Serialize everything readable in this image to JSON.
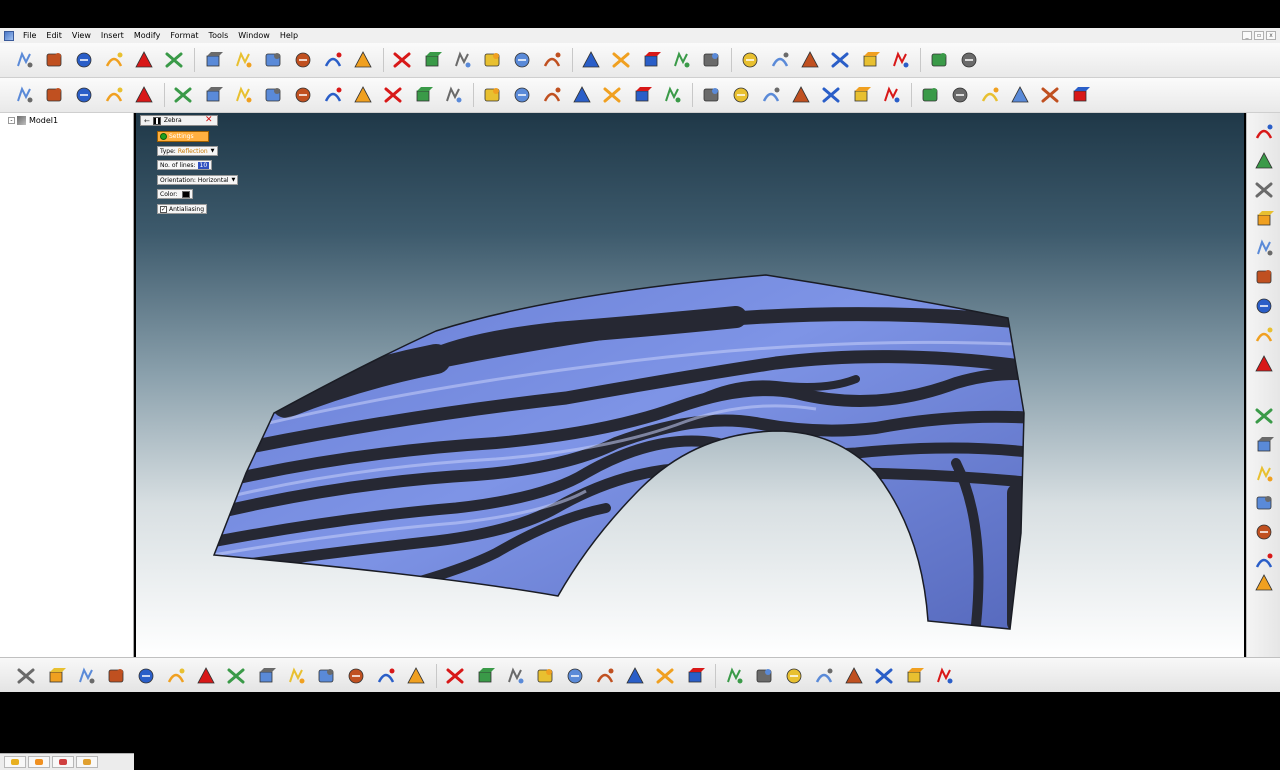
{
  "menubar": {
    "items": [
      "File",
      "Edit",
      "View",
      "Insert",
      "Modify",
      "Format",
      "Tools",
      "Window",
      "Help"
    ]
  },
  "tree": {
    "root_label": "Model1"
  },
  "zebra_panel": {
    "title": "Zebra",
    "check_label": "Settings",
    "type_label": "Type:",
    "type_value": "Reflection",
    "lines_label": "No. of lines:",
    "lines_value": "10",
    "orientation_label": "Orientation:",
    "orientation_value": "Horizontal",
    "color_label": "Color:",
    "antialias_label": "Antialiasing"
  },
  "colors": {
    "viewport_top": "#1f3848",
    "viewport_bottom": "#ffffff",
    "surface_light": "#7e94e6",
    "surface_dark": "#2a2c38",
    "accent_orange": "#f0a020",
    "accent_red": "#d81818",
    "accent_blue": "#2a5ec8"
  },
  "icons": {
    "toolbar1": [
      "new-icon",
      "open-icon",
      "save-icon",
      "undo-icon",
      "redo-icon",
      "copy-icon",
      "box-icon",
      "sphere-icon",
      "move-icon",
      "zoom-icon",
      "fit-icon",
      "grid-icon",
      "table-icon",
      "render-icon",
      "shade-icon",
      "wire-icon",
      "light-icon",
      "help-icon",
      "delete-icon",
      "trim-icon",
      "blend-icon",
      "extend-icon",
      "split-icon",
      "select-icon",
      "pick-icon",
      "measure-icon",
      "analyze-icon",
      "check-icon",
      "dimension-icon",
      "pen-icon",
      "brush-icon"
    ],
    "toolbar2": [
      "curve-icon",
      "line-icon",
      "circle-icon",
      "rectangle-icon",
      "arc-icon",
      "fillet-icon",
      "spline-icon",
      "offset-icon",
      "arrow-icon",
      "project-icon",
      "ellipse-icon",
      "mirror-icon",
      "swap-icon",
      "bottle-icon",
      "loop-icon",
      "sweep-icon",
      "loft-icon",
      "surface-icon",
      "patch-icon",
      "net-icon",
      "revolve-icon",
      "cap-icon",
      "image-icon",
      "texture-icon",
      "material-icon",
      "layer-icon",
      "scene-icon",
      "camera-icon",
      "view-icon",
      "orbit-icon",
      "section-icon",
      "frame-icon",
      "cube-icon",
      "cube2-icon",
      "cube3-icon"
    ],
    "right": [
      "sketch-icon",
      "trim-curve-icon",
      "extend-curve-icon",
      "fillet-curve-icon",
      "blend-curve-icon",
      "offset-curve-icon",
      "project-curve-icon",
      "intersect-icon",
      "silhouette-icon",
      "point-icon",
      "rotate-icon",
      "scale-icon",
      "mirror3d-icon",
      "array-icon",
      "align-icon",
      "attract-icon"
    ],
    "bottom": [
      "extrude-icon",
      "prism-icon",
      "revolve-solid-icon",
      "sweep-solid-icon",
      "loft-solid-icon",
      "shell-icon",
      "fillet-solid-icon",
      "chamfer-icon",
      "draft-icon",
      "split-solid-icon",
      "boolean-icon",
      "union-icon",
      "subtract-icon",
      "intersect-solid-icon",
      "cylinder-icon",
      "cone-icon",
      "torus-icon",
      "wedge-icon",
      "pyramid-icon",
      "tube-icon",
      "spring-icon",
      "pipe-icon",
      "cap-solid-icon",
      "mesh-icon",
      "smooth-icon",
      "decimate-icon",
      "repair-icon",
      "stitch-icon",
      "unstitch-icon",
      "heal-icon",
      "export-icon"
    ]
  }
}
